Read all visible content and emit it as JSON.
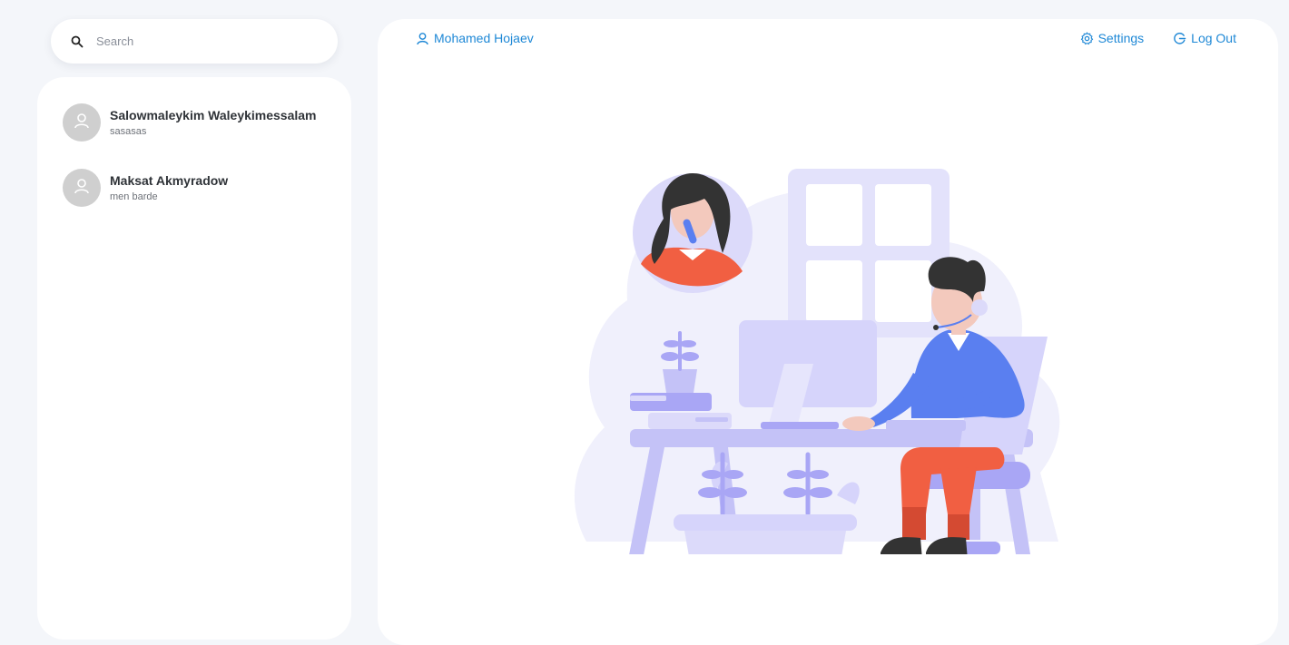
{
  "search": {
    "placeholder": "Search"
  },
  "contacts": [
    {
      "name": "Salowmaleykim Waleykimessalam",
      "last_message": "sasasas"
    },
    {
      "name": "Maksat Akmyradow",
      "last_message": "men barde"
    }
  ],
  "header": {
    "user_name": "Mohamed Hojaev",
    "settings_label": "Settings",
    "logout_label": "Log Out"
  },
  "colors": {
    "accent": "#1e88d6",
    "background": "#f4f6fa",
    "avatar": "#cfcfcf",
    "illustration_primary": "#a9a6f5",
    "illustration_light": "#ecebfc",
    "shirt": "#5a7ff0",
    "pants": "#f15f42"
  },
  "icons": {
    "search": "search-icon",
    "avatar": "user-icon",
    "user": "user-icon",
    "settings": "gear-icon",
    "logout": "logout-icon"
  }
}
